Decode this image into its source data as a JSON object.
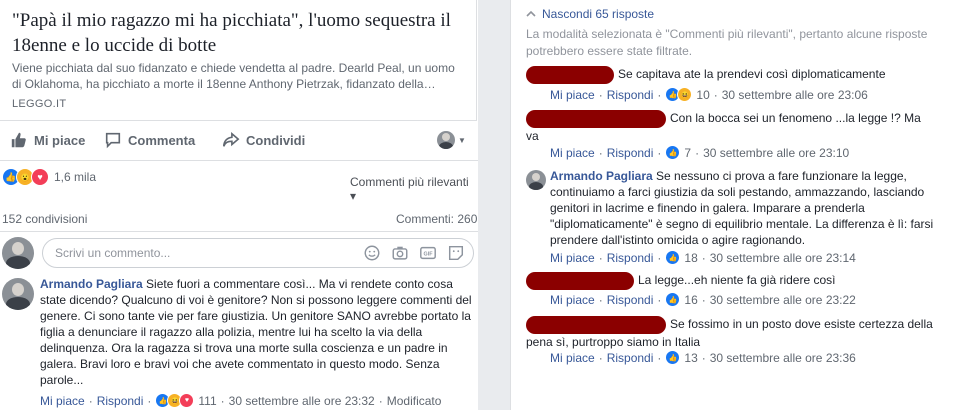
{
  "post": {
    "link_title": "\"Papà il mio ragazzo mi ha picchiata\", l'uomo sequestra il 18enne e lo uccide di botte",
    "link_desc": "Viene picchiata dal suo fidanzato e chiede vendetta al padre. Dearld Peal, un uomo di Oklahoma, ha picchiato a morte il 18enne Anthony Pietrzak, fidanzato della…",
    "link_source": "LEGGO.IT",
    "like_label": "Mi piace",
    "comment_label": "Commenta",
    "share_label": "Condividi",
    "reactions_count": "1,6 mila",
    "sort_label": "Commenti più rilevanti ▾",
    "shares_label": "152 condivisioni",
    "comments_label": "Commenti: 260",
    "composer_placeholder": "Scrivi un commento..."
  },
  "main_comment": {
    "author": "Armando Pagliara",
    "text": "Siete fuori a commentare così... Ma vi rendete conto cosa state dicendo? Qualcuno di voi è genitore? Non si possono leggere commenti del genere. Ci sono tante vie per fare giustizia. Un genitore SANO avrebbe portato la figlia a denunciare il ragazzo alla polizia, mentre lui ha scelto la via della delinquenza. Ora la ragazza si trova una morte sulla coscienza e un padre in galera. Bravi loro e bravi voi che avete commentato in questo modo. Senza parole...",
    "like": "Mi piace",
    "reply": "Rispondi",
    "reactions": "111",
    "time": "30 settembre alle ore 23:32",
    "edited": "Modificato"
  },
  "replies_panel": {
    "hide_label": "Nascondi 65 risposte",
    "notice": "La modalità selezionata è \"Commenti più rilevanti\", pertanto alcune risposte potrebbero essere state filtrate.",
    "replies": [
      {
        "author": "",
        "text": "Se capitava ate la prendevi così diplomaticamente",
        "like": "Mi piace",
        "reply": "Rispondi",
        "reactions": "10",
        "time": "30 settembre alle ore 23:06"
      },
      {
        "author": "",
        "text": "Con la bocca sei un fenomeno ...la legge !? Ma va",
        "like": "Mi piace",
        "reply": "Rispondi",
        "reactions": "7",
        "time": "30 settembre alle ore 23:10"
      },
      {
        "author": "Armando Pagliara",
        "text": "Se nessuno ci prova a fare funzionare la legge, continuiamo a farci giustizia da soli pestando, ammazzando, lasciando genitori in lacrime e finendo in galera. Imparare a prenderla \"diplomaticamente\" è segno di equilibrio mentale. La differenza è lì: farsi prendere dall'istinto omicida o agire ragionando.",
        "like": "Mi piace",
        "reply": "Rispondi",
        "reactions": "18",
        "time": "30 settembre alle ore 23:14"
      },
      {
        "author": "",
        "text": "La legge...eh niente fa già ridere così",
        "like": "Mi piace",
        "reply": "Rispondi",
        "reactions": "16",
        "time": "30 settembre alle ore 23:22"
      },
      {
        "author": "",
        "text": "Se fossimo in un posto dove esiste certezza della pena sì, purtroppo siamo in Italia",
        "like": "Mi piace",
        "reply": "Rispondi",
        "reactions": "13",
        "time": "30 settembre alle ore 23:36"
      }
    ]
  },
  "colors": {
    "link": "#385898",
    "like_blue": "#1877f2",
    "love_red": "#f33e58",
    "haha_yellow": "#f7b125",
    "redaction": "#8b0000"
  },
  "icons": [
    "thumbs-up-icon",
    "comment-bubble-icon",
    "share-arrow-icon",
    "emoji-icon",
    "camera-icon",
    "gif-icon",
    "sticker-icon",
    "love-reaction-icon",
    "wow-reaction-icon",
    "chevron-up-icon"
  ]
}
